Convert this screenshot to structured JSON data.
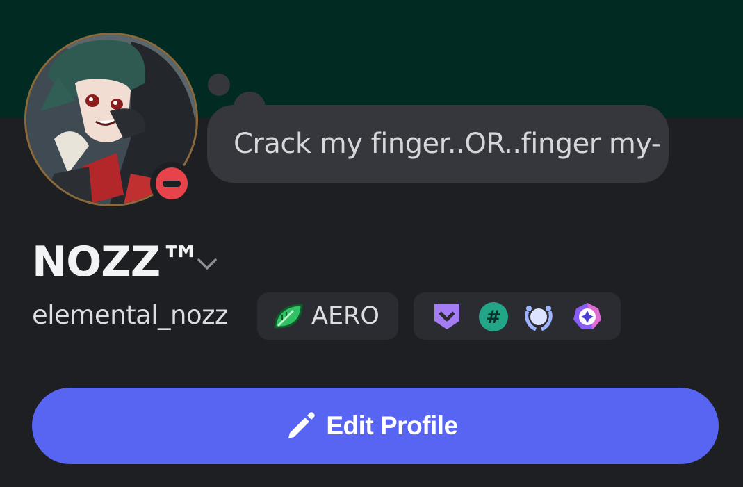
{
  "profile": {
    "display_name": "NOZZ™",
    "username": "elemental_nozz",
    "custom_status": "Crack my finger..OR..finger my-",
    "online_status": "do-not-disturb",
    "avatar_icon": "anime-character-avatar"
  },
  "guild_tag": {
    "icon": "green-leaf-icon",
    "label": "AERO"
  },
  "badges": [
    {
      "icon": "purple-chevron-shield-badge",
      "color": "#a47cf3"
    },
    {
      "icon": "green-hashtag-badge",
      "color": "#23a587"
    },
    {
      "icon": "blue-laurel-badge",
      "color": "#9fb4ff"
    },
    {
      "icon": "purple-crystal-badge",
      "color": "#8a5cf6"
    }
  ],
  "actions": {
    "edit_profile_label": "Edit Profile",
    "edit_profile_icon": "pencil-icon"
  },
  "colors": {
    "banner": "#002a22",
    "background": "#1e1f22",
    "button": "#5865f2",
    "status_dnd": "#e6444a"
  }
}
